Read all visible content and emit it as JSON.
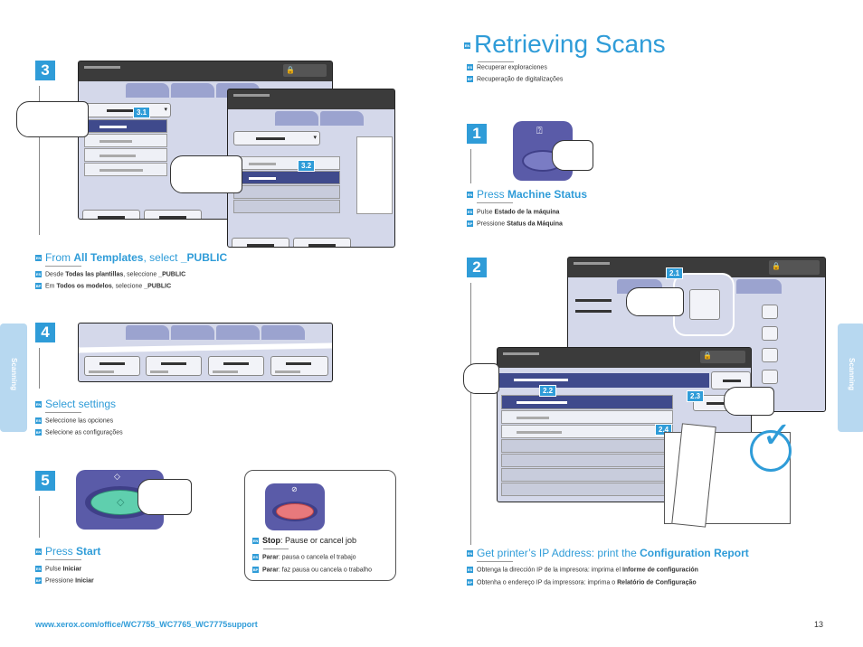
{
  "page": {
    "title": "Retrieving Scans",
    "title_lang": "EN",
    "subtitles": [
      {
        "lang": "ES",
        "text": "Recuperar exploraciones"
      },
      {
        "lang": "BP",
        "text": "Recuperação de digitalizações"
      }
    ],
    "side_tab_label": "Scanning",
    "footer_url": "www.xerox.com/office/WC7755_WC7765_WC7775support",
    "page_number": "13"
  },
  "steps": {
    "s3": {
      "number": "3",
      "callouts": [
        "3.1",
        "3.2"
      ],
      "en": {
        "lang": "EN",
        "pre": "From ",
        "b1": "All Templates",
        "mid": ", select ",
        "b2": "_PUBLIC"
      },
      "es": {
        "lang": "ES",
        "pre": "Desde ",
        "b1": "Todas las plantillas",
        "mid": ", seleccione ",
        "b2": "_PUBLIC"
      },
      "bp": {
        "lang": "BP",
        "pre": "Em ",
        "b1": "Todos os modelos",
        "mid": ", selecione ",
        "b2": "_PUBLIC"
      }
    },
    "s4": {
      "number": "4",
      "en": {
        "lang": "EN",
        "text": "Select settings"
      },
      "es": {
        "lang": "ES",
        "text": "Seleccione las opciones"
      },
      "bp": {
        "lang": "BP",
        "text": "Selecione as configurações"
      }
    },
    "s5": {
      "number": "5",
      "en": {
        "lang": "EN",
        "pre": "Press ",
        "b1": "Start"
      },
      "es": {
        "lang": "ES",
        "pre": "Pulse ",
        "b1": "Iniciar"
      },
      "bp": {
        "lang": "BP",
        "pre": "Pressione ",
        "b1": "Iniciar"
      }
    },
    "stop": {
      "en": {
        "lang": "EN",
        "b1": "Stop",
        "post": ": Pause or cancel job"
      },
      "es": {
        "lang": "ES",
        "b1": "Parar",
        "post": ": pausa o cancela el trabajo"
      },
      "bp": {
        "lang": "BP",
        "b1": "Parar",
        "post": ": faz pausa ou cancela o trabalho"
      }
    },
    "s1": {
      "number": "1",
      "en": {
        "lang": "EN",
        "pre": "Press ",
        "b1": "Machine Status"
      },
      "es": {
        "lang": "ES",
        "pre": "Pulse ",
        "b1": "Estado de la máquina"
      },
      "bp": {
        "lang": "BP",
        "pre": "Pressione ",
        "b1": "Status da Máquina"
      }
    },
    "s2": {
      "number": "2",
      "callouts": [
        "2.1",
        "2.2",
        "2.3",
        "2.4"
      ],
      "en": {
        "lang": "EN",
        "pre": "Get printer’s IP Address: print the ",
        "b1": "Configuration Report"
      },
      "es": {
        "lang": "ES",
        "pre": "Obtenga la dirección IP de la impresora: imprima el ",
        "b1": "Informe de configuración"
      },
      "bp": {
        "lang": "BP",
        "pre": "Obtenha o endereço IP da impressora: imprima o ",
        "b1": "Relatório de Configuração"
      }
    }
  },
  "colors": {
    "accent": "#2f9cd8",
    "panel": "#5a5ba8",
    "start_button": "#5fcfae",
    "stop_button": "#e8797c",
    "selected_row": "#3f4a8c"
  }
}
